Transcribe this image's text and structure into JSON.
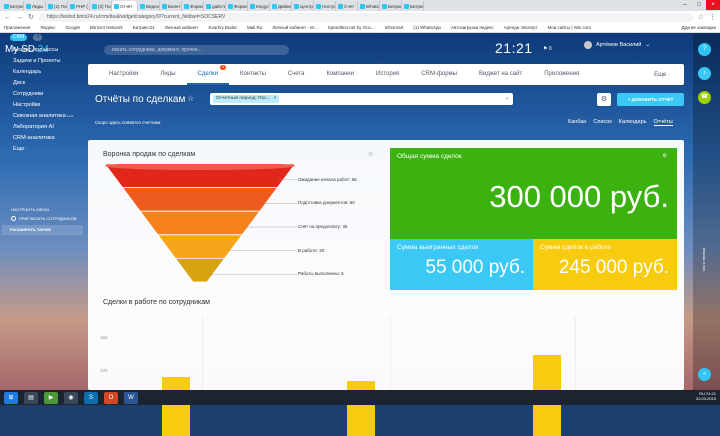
{
  "browser": {
    "tabs": [
      "Битрикс",
      "Лиды",
      "(2) Пост",
      "PHP (",
      "(2) Пос",
      "Отчёт",
      "Видео",
      "Билет",
      "Форма",
      "дайсте",
      "Форма",
      "Модул",
      "Дайжес",
      "Центр",
      "Настро",
      "Счёт",
      "WhatsA",
      "Битрикс",
      "Битрикс"
    ],
    "active_tab": "Отчёт",
    "url": "https://testsd.bitrix24.ru/crm/deal/widget/category/0/?current_fieldset=SOCSERV",
    "bookmarks": [
      "Приложения",
      "Яндекс",
      "Google",
      "Bitrix24 Network",
      "Битрикс24",
      "Личный кабинет",
      "Kvartiry Budar",
      "Mail.Ru",
      "Личный кабинет - М...",
      "Speedtest.net by Ooc...",
      "Infosmart",
      "(1) WhatsApp",
      "Автозагрузки яндекс",
      "Аренда Эксперт",
      "Мои сайты | Wix.com"
    ],
    "bookmarks_other": "Другие закладки"
  },
  "sidebar": {
    "logo": "My SD",
    "logo_num": "24",
    "crm_pill": "CRM",
    "crm_count": "4",
    "items": [
      {
        "label": "Бизнес-процессы",
        "sup": ""
      },
      {
        "label": "Задачи и Проекты",
        "sup": ""
      },
      {
        "label": "Календарь",
        "sup": ""
      },
      {
        "label": "Диск",
        "sup": ""
      },
      {
        "label": "Сотрудники",
        "sup": ""
      },
      {
        "label": "Настройки",
        "sup": ""
      },
      {
        "label": "Сквозная аналитика",
        "sup": "beta"
      },
      {
        "label": "Лаборатория AI",
        "sup": ""
      },
      {
        "label": "CRM-аналитика",
        "sup": ""
      },
      {
        "label": "Еще ·",
        "sup": ""
      }
    ],
    "config_menu": "Настроить меню",
    "invite": "Пригласить сотрудников",
    "tariff": "Расширить тариф"
  },
  "header": {
    "search_placeholder": "искать сотрудника, документ, прочее...",
    "time": "21:21",
    "notifications": "0",
    "user_name": "Артёмов Василий"
  },
  "crm_nav": {
    "items": [
      "Настройки",
      "Лиды",
      "Сделки",
      "Контакты",
      "Счета",
      "Компании",
      "История",
      "CRM-формы",
      "Виджет на сайт",
      "Приложения"
    ],
    "active": "Сделки",
    "active_badge": "4",
    "more": "Еще ·"
  },
  "page": {
    "title": "Отчёты по сделкам",
    "filter_chip": "Отчётный период: Пос...",
    "add_report": "ДОБАВИТЬ ОТЧЁТ",
    "counters_hint": "Скоро здесь появятся счетчики",
    "views": [
      "Канбан",
      "Список",
      "Календарь",
      "Отчёты"
    ],
    "active_view": "Отчёты"
  },
  "funnel_widget": {
    "title": "Воронка продаж по сделкам",
    "stages": [
      {
        "label": "Ожидание начала работ: 66"
      },
      {
        "label": "Подготовка документов: 50"
      },
      {
        "label": "Счёт на предоплату: 35"
      },
      {
        "label": "В работе: 20"
      },
      {
        "label": "Работы выполнены: 5"
      }
    ],
    "colors": [
      "#e1261c",
      "#ef5a1e",
      "#f7821c",
      "#f9a51a",
      "#d7a30e"
    ]
  },
  "tiles": {
    "total": {
      "title": "Общая сумма сделок",
      "value": "300 000 руб.",
      "color": "#3bb20f"
    },
    "won": {
      "title": "Сумма выигранных сделок",
      "value": "55 000 руб.",
      "color": "#3bc8f5"
    },
    "in_work": {
      "title": "Сумма сделок в работе",
      "value": "245 000 руб.",
      "color": "#f7cb0e"
    }
  },
  "bar_widget": {
    "title": "Сделки в работе по сотрудникам"
  },
  "chart_data": {
    "type": "bar",
    "title": "Сделки в работе по сотрудникам",
    "categories": [
      "",
      "",
      ""
    ],
    "values": [
      90,
      85,
      125
    ],
    "yticks": [
      50,
      100,
      150
    ],
    "ylim": [
      0,
      175
    ],
    "xlabel": "",
    "ylabel": "",
    "color": "#f7cb0e"
  },
  "right_rail": {
    "vertical_text": "Чат и звонки"
  },
  "tray": {
    "lang": "RU",
    "time": "21:21",
    "date": "20.03.2019"
  }
}
